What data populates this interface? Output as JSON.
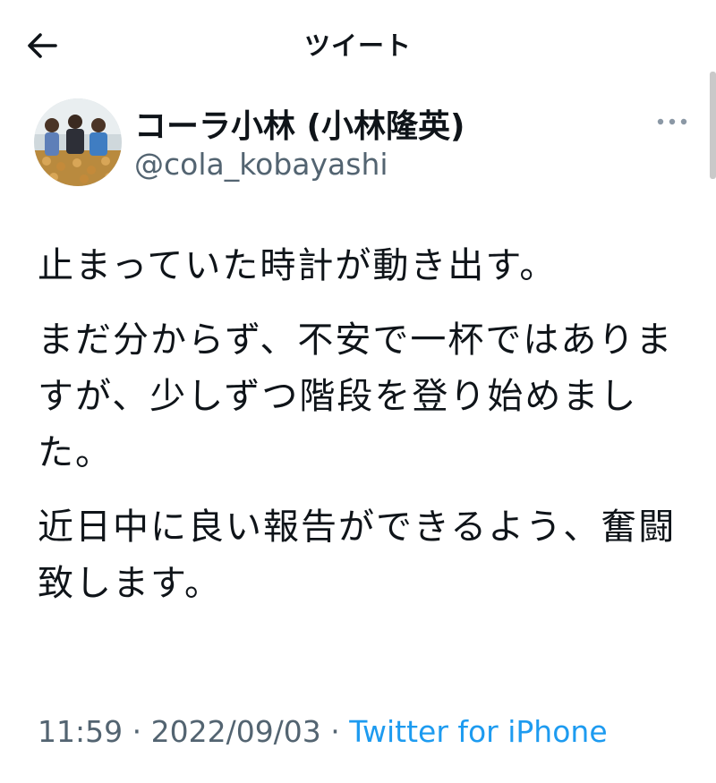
{
  "nav": {
    "title": "ツイート"
  },
  "tweet": {
    "author": {
      "display_name": "コーラ小林 (小林隆英)",
      "handle": "@cola_kobayashi"
    },
    "paragraphs": [
      "止まっていた時計が動き出す。",
      "まだ分からず、不安で一杯ではありますが、少しずつ階段を登り始めました。",
      "近日中に良い報告ができるよう、奮闘致します。"
    ],
    "meta": {
      "time": "11:59",
      "separator": " · ",
      "date": "2022/09/03",
      "source": "Twitter for iPhone"
    }
  },
  "icons": {
    "back": "arrow-left-icon",
    "more": "more-dots-icon"
  },
  "colors": {
    "text": "#0f1419",
    "secondary": "#536471",
    "link": "#1d9bf0"
  }
}
